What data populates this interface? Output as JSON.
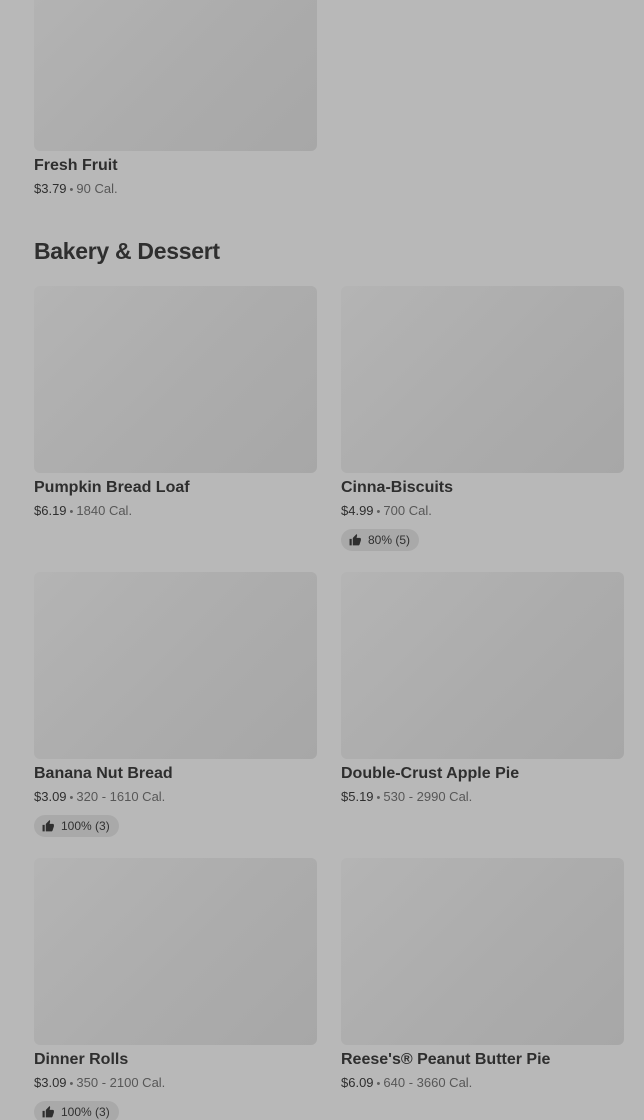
{
  "top_item": {
    "name": "Fresh Fruit",
    "price": "$3.79",
    "calories": "90 Cal."
  },
  "section": {
    "title": "Bakery & Dessert"
  },
  "items": [
    {
      "name": "Pumpkin Bread Loaf",
      "price": "$6.19",
      "calories": "1840 Cal.",
      "rating": ""
    },
    {
      "name": "Cinna-Biscuits",
      "price": "$4.99",
      "calories": "700 Cal.",
      "rating": "80% (5)"
    },
    {
      "name": "Banana Nut Bread",
      "price": "$3.09",
      "calories": "320 - 1610 Cal.",
      "rating": "100% (3)"
    },
    {
      "name": "Double-Crust Apple Pie",
      "price": "$5.19",
      "calories": "530 - 2990 Cal.",
      "rating": ""
    },
    {
      "name": "Dinner Rolls",
      "price": "$3.09",
      "calories": "350 - 2100 Cal.",
      "rating": "100% (3)"
    },
    {
      "name": "Reese's® Peanut Butter Pie",
      "price": "$6.09",
      "calories": "640 - 3660 Cal.",
      "rating": ""
    }
  ],
  "separator": "•",
  "icons": {
    "rating": "thumbs-up-icon"
  },
  "colors": {
    "background": "#b8b8b8",
    "image_placeholder": "#acacac",
    "badge": "#a9a9a9"
  }
}
